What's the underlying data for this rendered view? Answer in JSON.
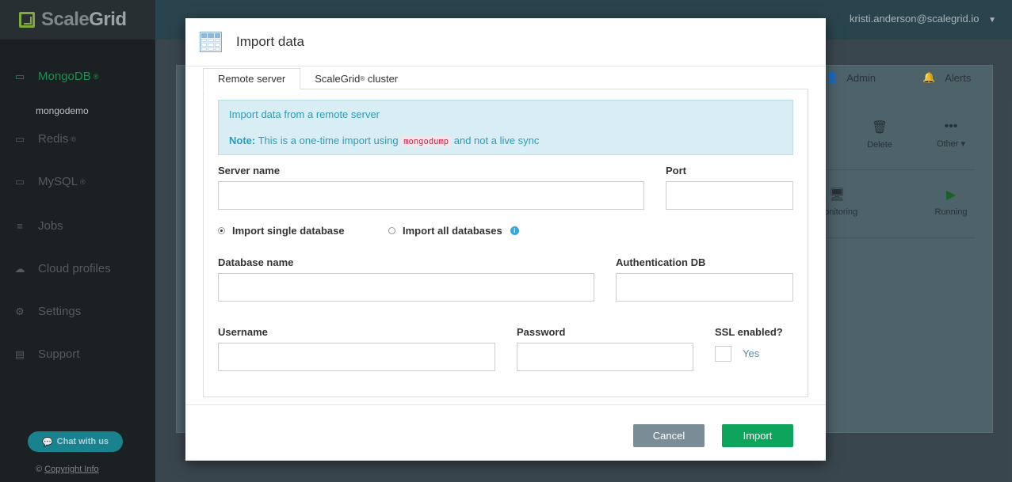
{
  "brand": {
    "name_part1": "Scale",
    "name_part2": "Grid"
  },
  "user": {
    "email": "kristi.anderson@scalegrid.io"
  },
  "sidebar": {
    "items": [
      {
        "label": "MongoDB",
        "sup": "®",
        "active": true
      },
      {
        "label": "Redis",
        "sup": "®"
      },
      {
        "label": "MySQL",
        "sup": "®"
      },
      {
        "label": "Jobs",
        "sup": ""
      },
      {
        "label": "Cloud profiles",
        "sup": ""
      },
      {
        "label": "Settings",
        "sup": ""
      },
      {
        "label": "Support",
        "sup": ""
      }
    ],
    "sub_item": "mongodemo",
    "chat_label": "Chat with us",
    "copyright_prefix": "©",
    "copyright_link": "Copyright Info"
  },
  "background": {
    "tabs": [
      "Admin",
      "Alerts"
    ],
    "tools": [
      "Delete",
      "Other",
      "onitoring",
      "Running"
    ]
  },
  "modal": {
    "title": "Import data",
    "tabs": [
      {
        "label": "ScaleGrid",
        "sup": "",
        "label_after": ""
      },
      {
        "label": "ScaleGrid",
        "sup": "®",
        "label_after": " cluster"
      }
    ],
    "tab_active": "Remote server",
    "info_line": "Import data from a remote server",
    "note_label": "Note:",
    "note_before": " This is a one-time import using ",
    "note_code": "mongodump",
    "note_after": " and not a live sync",
    "fields": {
      "server_name": "Server name",
      "port": "Port",
      "database_name": "Database name",
      "auth_db": "Authentication DB",
      "username": "Username",
      "password": "Password",
      "ssl": "SSL enabled?"
    },
    "radios": {
      "single": "Import single database",
      "all": "Import all databases"
    },
    "ssl_yes": "Yes",
    "cancel": "Cancel",
    "import": "Import"
  },
  "colors": {
    "primary": "#0fa45c",
    "info_text": "#2b9bb8",
    "sidebar_active": "#1b9e57"
  }
}
